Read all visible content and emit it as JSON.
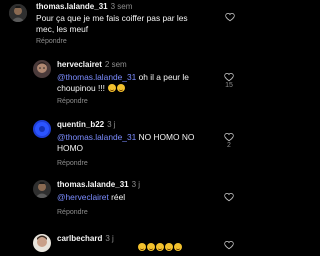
{
  "comments": [
    {
      "username": "thomas.lalande_31",
      "age": "3 sem",
      "text": "Pour ça que je me fais coiffer pas par les mec, les meuf",
      "reply": "Répondre",
      "likes": ""
    },
    {
      "username": "hervecl​airet",
      "age": "2 sem",
      "mention": "@thomas.lalande_31",
      "text": "oh il a peur le choupinou !!!",
      "reply": "Répondre",
      "likes": "15"
    },
    {
      "username": "quentin_b22",
      "age": "3 j",
      "mention": "@thomas.lalande_31",
      "text": "NO HOMO NO HOMO",
      "reply": "Répondre",
      "likes": "2"
    },
    {
      "username": "thomas.lalande_31",
      "age": "3 j",
      "mention": "@herveclairet",
      "text": "réel",
      "reply": "Répondre",
      "likes": ""
    },
    {
      "username": "carlbechard",
      "age": "3 j",
      "text": "",
      "reply": "",
      "likes": ""
    }
  ],
  "icons": {
    "like": "heart-outline-icon"
  },
  "colors": {
    "mention": "#7b8cff",
    "muted": "#8e8e8e",
    "background": "#000000"
  }
}
